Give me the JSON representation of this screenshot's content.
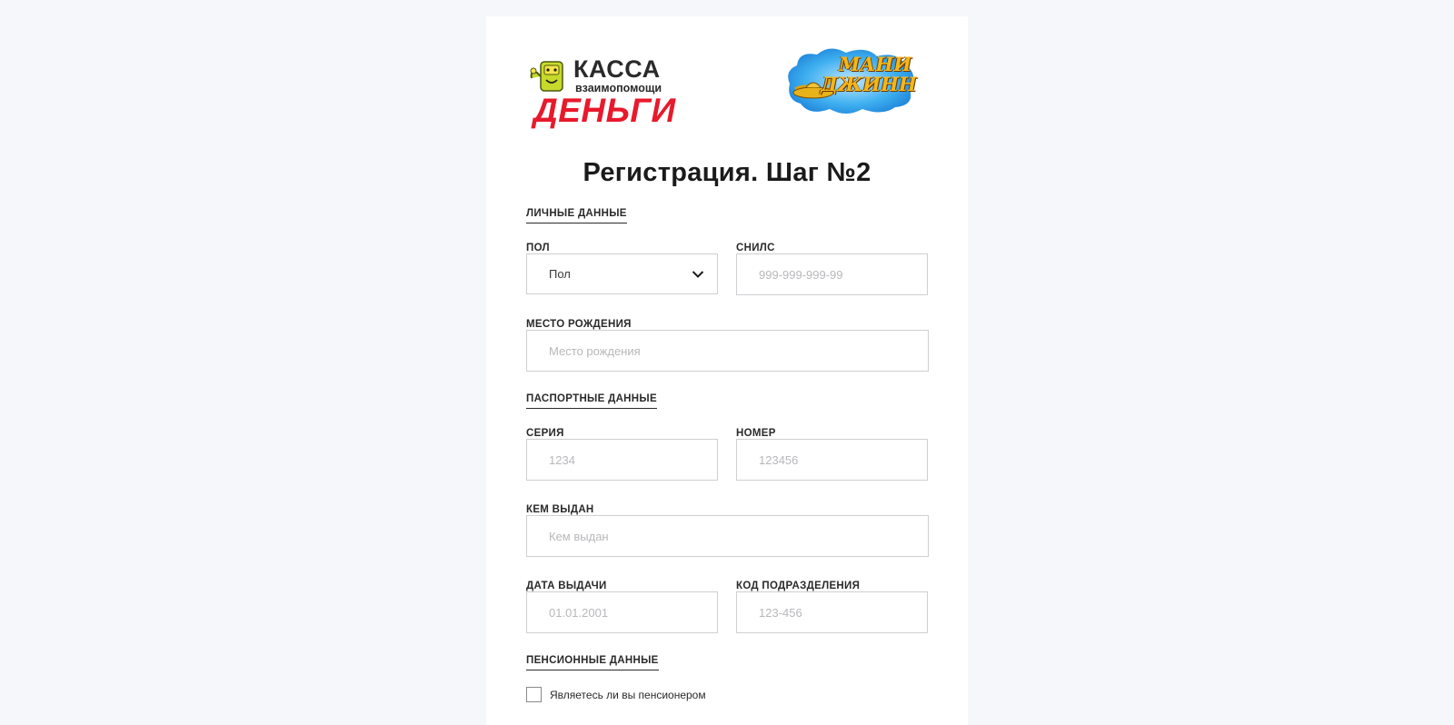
{
  "logos": {
    "kassa": {
      "line1": "КАССА",
      "line2": "взаимопомощи",
      "line3": "ДЕНЬГИ",
      "brand_color": "#e8192c"
    },
    "genie": {
      "line1": "МАНИ",
      "line2": "ДЖИНН"
    }
  },
  "page_title": "Регистрация. Шаг №2",
  "sections": {
    "personal": "ЛИЧНЫЕ ДАННЫЕ",
    "passport": "ПАСПОРТНЫЕ ДАННЫЕ",
    "pension": "ПЕНСИОННЫЕ ДАННЫЕ"
  },
  "fields": {
    "gender": {
      "label": "ПОЛ",
      "value": "Пол"
    },
    "snils": {
      "label": "СНИЛС",
      "placeholder": "999-999-999-99"
    },
    "birthplace": {
      "label": "МЕСТО РОЖДЕНИЯ",
      "placeholder": "Место рождения"
    },
    "series": {
      "label": "СЕРИЯ",
      "placeholder": "1234"
    },
    "number": {
      "label": "НОМЕР",
      "placeholder": "123456"
    },
    "issued_by": {
      "label": "КЕМ ВЫДАН",
      "placeholder": "Кем выдан"
    },
    "issue_date": {
      "label": "ДАТА ВЫДАЧИ",
      "placeholder": "01.01.2001"
    },
    "dept_code": {
      "label": "КОД ПОДРАЗДЕЛЕНИЯ",
      "placeholder": "123-456"
    }
  },
  "pensioner_checkbox": {
    "label": "Являетесь ли вы пенсионером",
    "checked": false
  },
  "colors": {
    "background": "#f6f7fa",
    "card": "#ffffff",
    "border": "#cfcfd4",
    "placeholder": "#b8b8bc"
  }
}
